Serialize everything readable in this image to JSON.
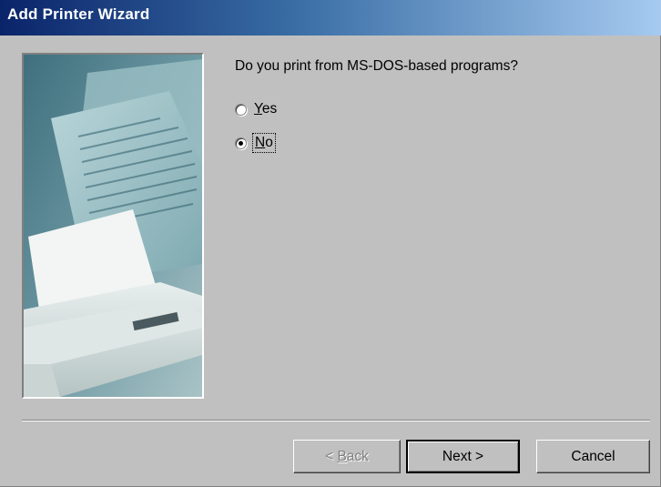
{
  "window": {
    "title": "Add Printer Wizard"
  },
  "picture": {
    "name": "printer-illustration"
  },
  "main": {
    "question": "Do you print from MS-DOS-based programs?",
    "options": [
      {
        "label_access": "Y",
        "label_rest": "es",
        "checked": false
      },
      {
        "label_access": "N",
        "label_rest": "o",
        "checked": true
      }
    ]
  },
  "buttons": {
    "back_prefix": "< ",
    "back_access": "B",
    "back_rest": "ack",
    "next": "Next >",
    "cancel": "Cancel"
  }
}
